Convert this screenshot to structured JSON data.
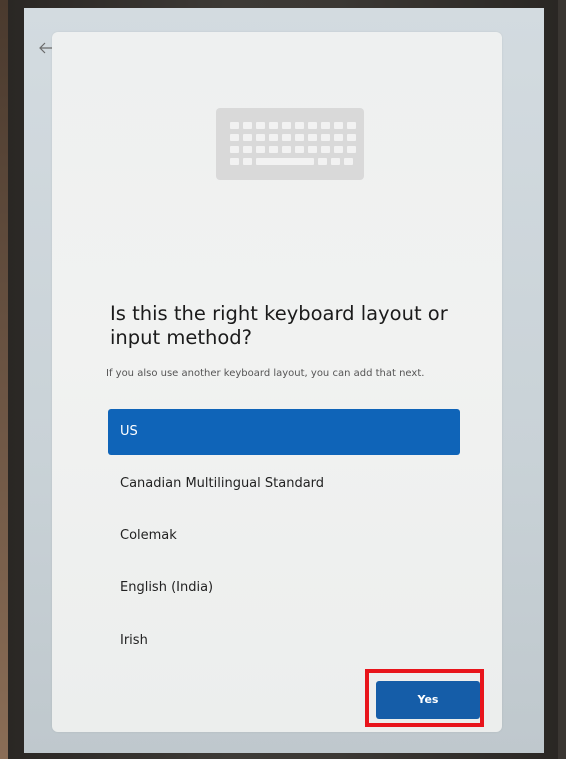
{
  "header": {
    "back_icon": "arrow-left-icon",
    "illustration_icon": "keyboard-icon"
  },
  "main": {
    "title": "Is this the right keyboard layout or input method?",
    "subtitle": "If you also use another keyboard layout, you can add that next.",
    "options": [
      {
        "label": "US",
        "selected": true
      },
      {
        "label": "Canadian Multilingual Standard",
        "selected": false
      },
      {
        "label": "Colemak",
        "selected": false
      },
      {
        "label": "English (India)",
        "selected": false
      },
      {
        "label": "Irish",
        "selected": false
      }
    ]
  },
  "footer": {
    "yes_label": "Yes"
  },
  "colors": {
    "accent": "#0f64b8",
    "button": "#155da8",
    "highlight": "#e8141b"
  }
}
